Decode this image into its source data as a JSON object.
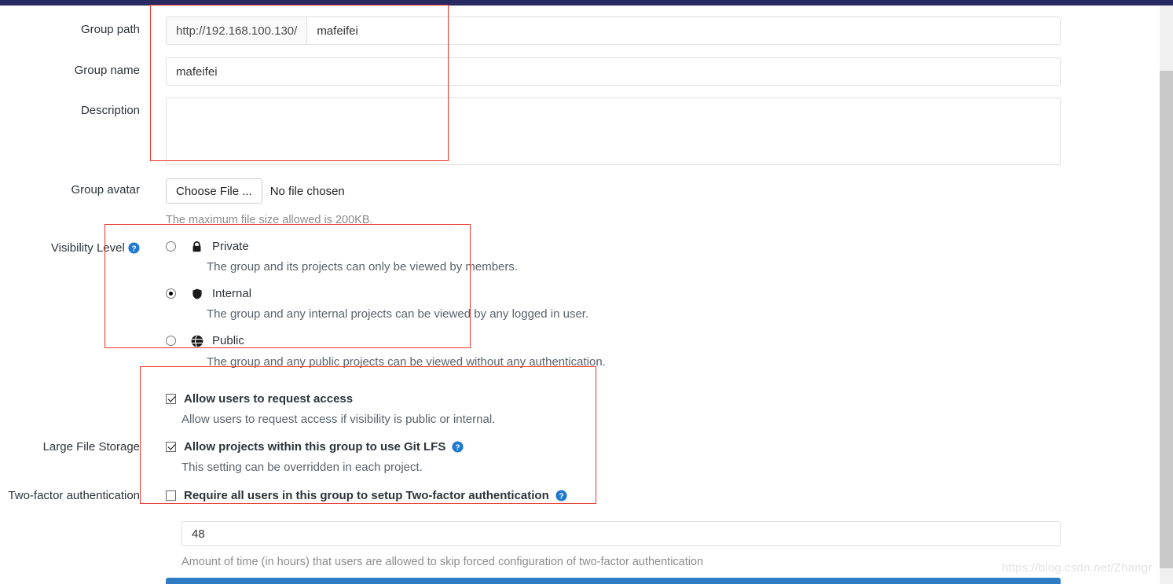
{
  "colors": {
    "topbar": "#292961",
    "annotation": "#e8352b",
    "submit_button": "#2e7cc4",
    "help_icon": "#1f78d1",
    "scroll_thumb": "#c9c9c9"
  },
  "form": {
    "group_path": {
      "label": "Group path",
      "prefix": "http://192.168.100.130/",
      "value": "mafeifei",
      "placeholder": ""
    },
    "group_name": {
      "label": "Group name",
      "value": "mafeifei",
      "placeholder": ""
    },
    "description": {
      "label": "Description",
      "value": "",
      "placeholder": ""
    },
    "group_avatar": {
      "label": "Group avatar",
      "button_label": "Choose File ...",
      "file_status": "No file chosen",
      "hint": "The maximum file size allowed is 200KB."
    },
    "visibility": {
      "label": "Visibility Level",
      "help_icon": "question-circle-icon",
      "selected": "internal",
      "options": [
        {
          "id": "private",
          "icon": "lock-icon",
          "label": "Private",
          "description": "The group and its projects can only be viewed by members.",
          "checked": false
        },
        {
          "id": "internal",
          "icon": "shield-icon",
          "label": "Internal",
          "description": "The group and any internal projects can be viewed by any logged in user.",
          "checked": true
        },
        {
          "id": "public",
          "icon": "globe-icon",
          "label": "Public",
          "description": "The group and any public projects can be viewed without any authentication.",
          "checked": false
        }
      ]
    },
    "request_access": {
      "label": "Allow users to request access",
      "description": "Allow users to request access if visibility is public or internal.",
      "checked": true
    },
    "large_file_storage": {
      "label": "Large File Storage",
      "checkbox_label": "Allow projects within this group to use Git LFS",
      "help_icon": "question-circle-icon",
      "description": "This setting can be overridden in each project.",
      "checked": true
    },
    "two_factor": {
      "label": "Two-factor authentication",
      "checkbox_label": "Require all users in this group to setup Two-factor authentication",
      "help_icon": "question-circle-icon",
      "checked": false
    },
    "grace_period": {
      "value": "48",
      "placeholder": "",
      "hint": "Amount of time (in hours) that users are allowed to skip forced configuration of two-factor authentication"
    }
  },
  "watermark": {
    "text": "https://blog.csdn.net/Zhangr"
  }
}
